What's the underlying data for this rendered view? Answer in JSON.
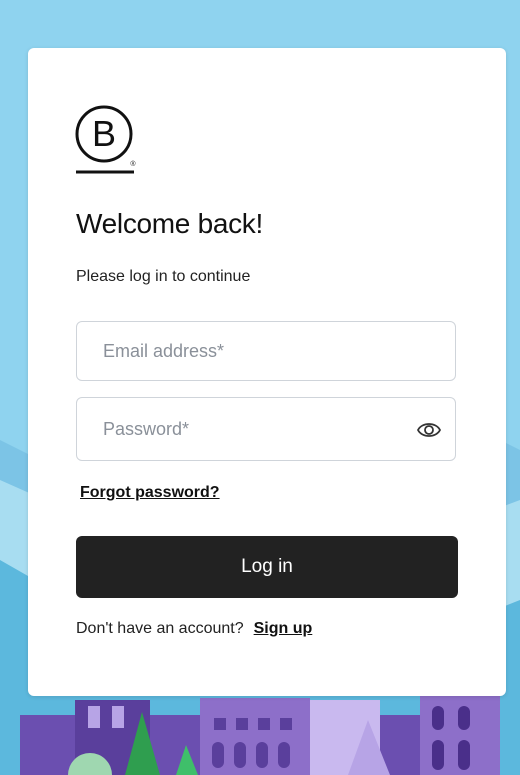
{
  "brand": {
    "logo_letter": "B",
    "logo_mark": "®"
  },
  "login": {
    "title": "Welcome back!",
    "subtitle": "Please log in to continue",
    "email_placeholder": "Email address*",
    "password_placeholder": "Password*",
    "forgot_label": "Forgot password?",
    "submit_label": "Log in",
    "signup_prompt": "Don't have an account?",
    "signup_label": "Sign up"
  },
  "icons": {
    "password_toggle": "eye-icon"
  },
  "colors": {
    "sky": "#8fd3ef",
    "button": "#222222",
    "buildings": "#8d6fc9",
    "trees": "#2f9e4f"
  }
}
